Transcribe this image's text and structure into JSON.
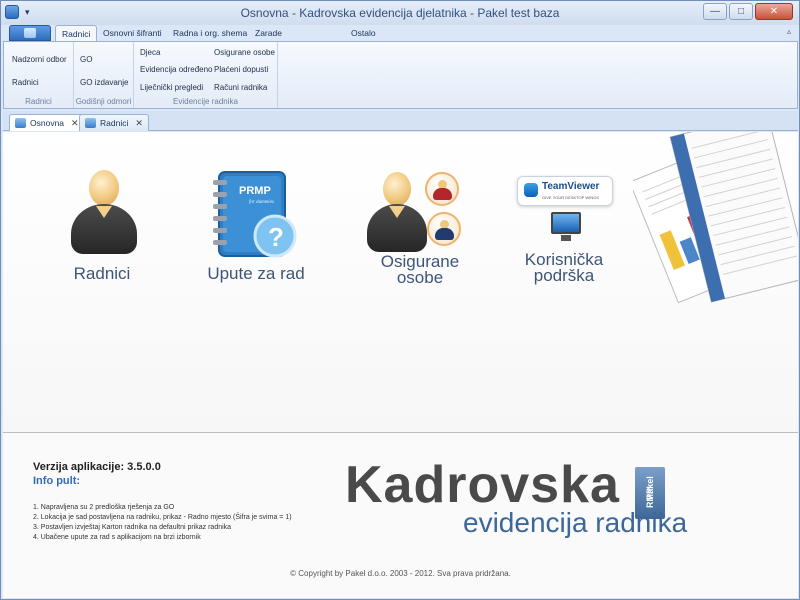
{
  "window": {
    "title": "Osnovna - Kadrovska evidencija djelatnika - Pakel test baza",
    "qat_dropdown": "▾",
    "controls": {
      "minimize": "—",
      "maximize": "□",
      "close": "✕"
    }
  },
  "ribbon": {
    "tabs": [
      "Radnici",
      "Osnovni šifranti",
      "Radna i org. shema",
      "Zarade",
      "Ostalo"
    ],
    "active_tab": "Radnici",
    "collapse": "▵",
    "groups": [
      {
        "label": "Radnici",
        "items": [
          "Nadzorni odbor",
          "Radnici"
        ]
      },
      {
        "label": "Godišnji odmori",
        "items": [
          "GO",
          "GO izdavanje"
        ]
      },
      {
        "label": "Evidencije radnika",
        "items": [
          "Djeca",
          "Evidencija određeno",
          "Liječnički pregledi",
          "Osigurane osobe",
          "Plaćeni dopusti",
          "Računi radnika"
        ]
      }
    ]
  },
  "doc_tabs": [
    {
      "label": "Osnovna",
      "close": "✕",
      "active": true
    },
    {
      "label": "Radnici",
      "close": "✕",
      "active": false
    }
  ],
  "tiles": {
    "radnici": "Radnici",
    "upute": "Upute za rad",
    "osigurane_line1": "Osigurane",
    "osigurane_line2": "osobe",
    "podrska_line1": "Korisnička",
    "podrska_line2": "podrška",
    "prmp_book_title": "PRMP",
    "prmp_book_sub": "for dummies",
    "question_mark": "?",
    "teamviewer": "TeamViewer",
    "teamviewer_sub": "GIVE YOUR DESKTOP WINGS"
  },
  "info": {
    "version": "Verzija aplikacije: 3.5.0.0",
    "title": "Info pult:",
    "items": [
      "1. Napravljena su 2 predloška rješenja za GO",
      "2. Lokacija je sad postavljena na radniku, prikaz - Radno mjesto (Šifra je svima = 1)",
      "3. Postavljen izvještaj Karton radnika na defaultni prikaz radnika",
      "4. Ubačene upute za rad s aplikacijom na brzi izbornik"
    ]
  },
  "brand": {
    "line1": "Kadrovska",
    "badge_top": "Pakel",
    "badge_bottom": "RMP",
    "line2": "evidencija radnika"
  },
  "footer": {
    "copyright": "© Copyright by Pakel d.o.o. 2003 - 2012. Sva prava pridržana."
  },
  "colors": {
    "accent": "#2e6bbd",
    "tile_text": "#3d5677",
    "brand_blue": "#3c679a"
  }
}
